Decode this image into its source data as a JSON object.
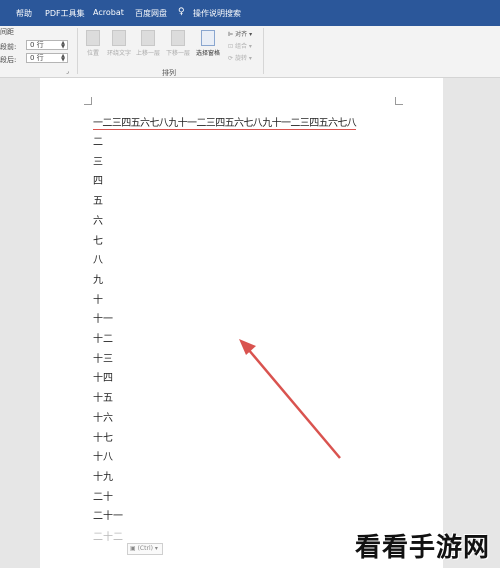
{
  "tabs": [
    {
      "label": "帮助"
    },
    {
      "label": "PDF工具集"
    },
    {
      "label": "Acrobat"
    },
    {
      "label": "百度网盘"
    },
    {
      "label": "操作说明搜索"
    }
  ],
  "ribbon": {
    "spacing_title": "间距",
    "before_label": "段前:",
    "before_value": "0 行",
    "after_label": "段后:",
    "after_value": "0 行",
    "arrange_buttons": [
      {
        "label": "位置"
      },
      {
        "label": "环绕文字"
      },
      {
        "label": "上移一层"
      },
      {
        "label": "下移一层"
      },
      {
        "label": "选择窗格"
      }
    ],
    "align_label": "对齐",
    "group_label": "组合",
    "rotate_label": "旋转",
    "arrange_group_label": "排列"
  },
  "document": {
    "first_line": "一二三四五六七八九十一二三四五六七八九十一二三四五六七八",
    "lines": [
      "二",
      "三",
      "四",
      "五",
      "六",
      "七",
      "八",
      "九",
      "十",
      "十一",
      "十二",
      "十三",
      "十四",
      "十五",
      "十六",
      "十七",
      "十八",
      "十九",
      "二十",
      "二十一"
    ],
    "faded_line": "二十二",
    "paste_label": "(Ctrl)"
  },
  "watermark": "看看手游网",
  "colors": {
    "tabbar": "#2b579a",
    "underline": "#d9534f",
    "arrow": "#d9534f"
  }
}
